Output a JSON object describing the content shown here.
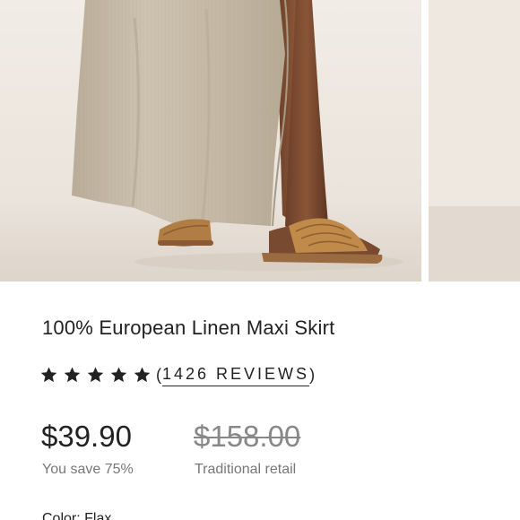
{
  "product": {
    "title": "100% European Linen Maxi Skirt",
    "rating": 5,
    "review_count_text": "1426 REVIEWS",
    "paren_open": "(",
    "paren_close": ")"
  },
  "pricing": {
    "price": "$39.90",
    "original_price": "$158.00",
    "savings_text": "You save 75%",
    "original_label": "Traditional retail"
  },
  "options": {
    "color_label": "Color: Flax"
  },
  "images": {
    "main": "product-photo-linen-skirt-sandals",
    "next": "product-photo-next-partial"
  },
  "colors": {
    "text": "#222222",
    "muted": "#777777",
    "strike": "#888888",
    "linen": "#c6bba8",
    "backdrop": "#ece6df"
  }
}
